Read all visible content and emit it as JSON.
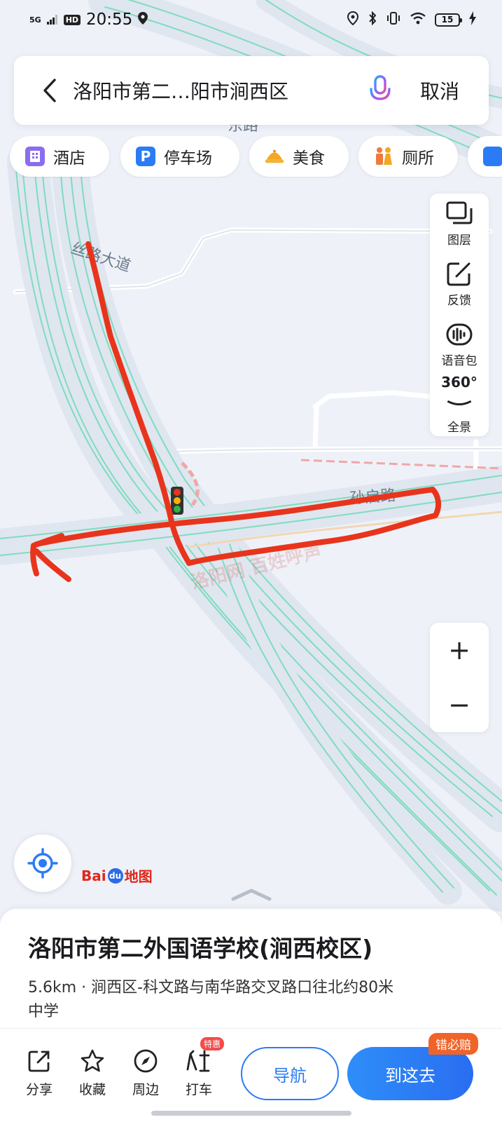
{
  "status_bar": {
    "network": "5G",
    "hd": "HD",
    "time": "20:55",
    "battery": "15",
    "icons": [
      "location-icon",
      "bluetooth-icon",
      "vibrate-icon",
      "wifi-icon",
      "charging-icon"
    ]
  },
  "search": {
    "query": "洛阳市第二…阳市涧西区",
    "cancel_label": "取消"
  },
  "categories": [
    {
      "label": "酒店",
      "icon": "hotel-icon",
      "color": "#8b6cf0"
    },
    {
      "label": "停车场",
      "icon": "parking-icon",
      "color": "#2b7bf6"
    },
    {
      "label": "美食",
      "icon": "food-icon",
      "color": "#f5a623"
    },
    {
      "label": "厕所",
      "icon": "toilet-icon",
      "color": "#f07a3a"
    }
  ],
  "tools": {
    "layers_label": "图层",
    "feedback_label": "反馈",
    "voice_label": "语音包",
    "panorama_label": "全景",
    "panorama_badge": "360°"
  },
  "zoom": {
    "in": "+",
    "out": "−"
  },
  "map": {
    "road_labels": {
      "silk_road": "丝路大道",
      "partial_road_top": "东路",
      "sun_road": "孙启路"
    },
    "logo_text": "Bai",
    "logo_suffix": "地图",
    "colors": {
      "route_annotation": "#e8341c",
      "road": "#d6dde8",
      "traffic_line": "#5fd6b4"
    }
  },
  "poi": {
    "title": "洛阳市第二外国语学校(涧西校区)",
    "address": "5.6km · 涧西区-科文路与南华路交叉路口往北约80米",
    "type": "中学"
  },
  "actions": {
    "share": "分享",
    "favorite": "收藏",
    "nearby": "周边",
    "taxi": "打车",
    "taxi_badge": "特惠",
    "navigate": "导航",
    "go_here": "到这去",
    "promo": "错必赔"
  },
  "watermark": "洛阳网 百姓呼声"
}
